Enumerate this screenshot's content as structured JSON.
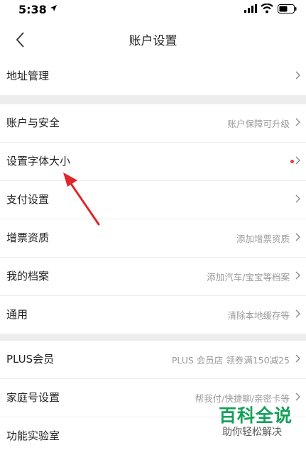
{
  "status_bar": {
    "time": "5:38"
  },
  "nav": {
    "title": "账户设置"
  },
  "groups": [
    {
      "rows": [
        {
          "label": "地址管理",
          "value": ""
        }
      ]
    },
    {
      "rows": [
        {
          "label": "账户与安全",
          "value": "账户保障可升级"
        },
        {
          "label": "设置字体大小",
          "value": ""
        },
        {
          "label": "支付设置",
          "value": ""
        },
        {
          "label": "增票资质",
          "value": "添加增票资质"
        },
        {
          "label": "我的档案",
          "value": "添加汽车/宝宝等档案"
        },
        {
          "label": "通用",
          "value": "清除本地缓存等"
        }
      ]
    },
    {
      "rows": [
        {
          "label": "PLUS会员",
          "value": "PLUS 会员店 领券满150减25"
        },
        {
          "label": "家庭号设置",
          "value": "帮我付/快捷聊/亲密卡等"
        },
        {
          "label": "功能实验室",
          "value": ""
        }
      ]
    }
  ],
  "colors": {
    "annotation_arrow": "#e0262b",
    "watermark": "#16a05a",
    "red_dot": "#e93b3d"
  },
  "watermark": {
    "title": "百科全说",
    "subtitle": "助你轻松解决"
  }
}
